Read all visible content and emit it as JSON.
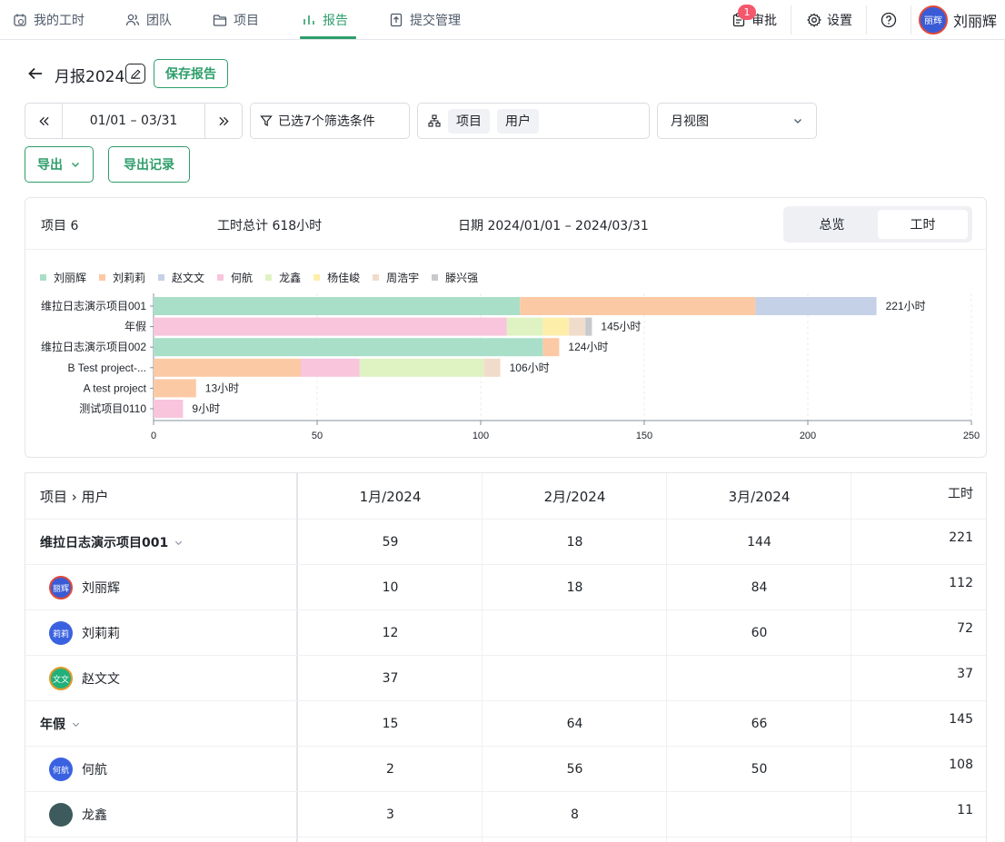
{
  "nav": {
    "items": [
      {
        "label": "我的工时",
        "icon": "clock-calendar-icon"
      },
      {
        "label": "团队",
        "icon": "team-icon"
      },
      {
        "label": "项目",
        "icon": "folder-icon"
      },
      {
        "label": "报告",
        "icon": "bar-chart-icon",
        "active": true
      },
      {
        "label": "提交管理",
        "icon": "upload-doc-icon"
      }
    ],
    "approval_label": "审批",
    "approval_badge": "1",
    "settings_label": "设置",
    "user_name": "刘丽辉",
    "user_avatar_text": "丽辉"
  },
  "report": {
    "title": "月报2024",
    "save_label": "保存报告",
    "date_range": "01/01 – 03/31",
    "filter_label": "已选7个筛选条件",
    "group_tags": [
      "项目",
      "用户"
    ],
    "view_select": "月视图",
    "export_label": "导出",
    "export_history_label": "导出记录"
  },
  "summary": {
    "projects": "项目 6",
    "total_hours": "工时总计 618小时",
    "date": "日期 2024/01/01 – 2024/03/31",
    "tabs": [
      "总览",
      "工时"
    ],
    "active_tab": "工时"
  },
  "chart_data": {
    "type": "bar",
    "orientation": "horizontal",
    "stacked": true,
    "categories": [
      "维拉日志演示项目001",
      "年假",
      "维拉日志演示项目002",
      "B Test project-...",
      "A test project",
      "测试项目0110"
    ],
    "series": [
      {
        "name": "刘丽辉",
        "color": "#a9dfc8",
        "values": [
          112,
          0,
          119,
          0,
          0,
          0
        ]
      },
      {
        "name": "刘莉莉",
        "color": "#fcc9a5",
        "values": [
          72,
          0,
          5,
          45,
          13,
          0
        ]
      },
      {
        "name": "赵文文",
        "color": "#c5d1e6",
        "values": [
          37,
          0,
          0,
          0,
          0,
          0
        ]
      },
      {
        "name": "何航",
        "color": "#f8c5dd",
        "values": [
          0,
          108,
          0,
          18,
          0,
          9
        ]
      },
      {
        "name": "龙鑫",
        "color": "#dff2c2",
        "values": [
          0,
          11,
          0,
          38,
          0,
          0
        ]
      },
      {
        "name": "杨佳峻",
        "color": "#fdeeaa",
        "values": [
          0,
          8,
          0,
          0,
          0,
          0
        ]
      },
      {
        "name": "周浩宇",
        "color": "#f1dccb",
        "values": [
          0,
          5,
          0,
          5,
          0,
          0
        ]
      },
      {
        "name": "滕兴强",
        "color": "#c8c9cc",
        "values": [
          0,
          2,
          0,
          0,
          0,
          0
        ]
      }
    ],
    "totals_labels": [
      "221小时",
      "145小时",
      "124小时",
      "106小时",
      "13小时",
      "9小时"
    ],
    "xlim": [
      0,
      250
    ],
    "xticks": [
      "0",
      "50",
      "100",
      "150",
      "200",
      "250"
    ],
    "grid": true,
    "legend": "top-left"
  },
  "table": {
    "headers": [
      "项目 › 用户",
      "1月/2024",
      "2月/2024",
      "3月/2024",
      "工时"
    ],
    "rows": [
      {
        "type": "group",
        "name": "维拉日志演示项目001",
        "m1": "59",
        "m2": "18",
        "m3": "144",
        "total": "221"
      },
      {
        "type": "user",
        "name": "刘丽辉",
        "avatar": "丽辉",
        "avatar_color": "#3a5bd6",
        "m1": "10",
        "m2": "18",
        "m3": "84",
        "total": "112"
      },
      {
        "type": "user",
        "name": "刘莉莉",
        "avatar": "莉莉",
        "avatar_color": "#3a62e0",
        "m1": "12",
        "m2": "",
        "m3": "60",
        "total": "72"
      },
      {
        "type": "user",
        "name": "赵文文",
        "avatar": "文文",
        "avatar_color": "#22b07a",
        "m1": "37",
        "m2": "",
        "m3": "",
        "total": "37"
      },
      {
        "type": "group",
        "name": "年假",
        "m1": "15",
        "m2": "64",
        "m3": "66",
        "total": "145"
      },
      {
        "type": "user",
        "name": "何航",
        "avatar": "何航",
        "avatar_color": "#3a62e0",
        "m1": "2",
        "m2": "56",
        "m3": "50",
        "total": "108"
      },
      {
        "type": "user",
        "name": "龙鑫",
        "avatar": "",
        "avatar_color": "#3d5a5c",
        "m1": "3",
        "m2": "8",
        "m3": "",
        "total": "11"
      }
    ]
  }
}
